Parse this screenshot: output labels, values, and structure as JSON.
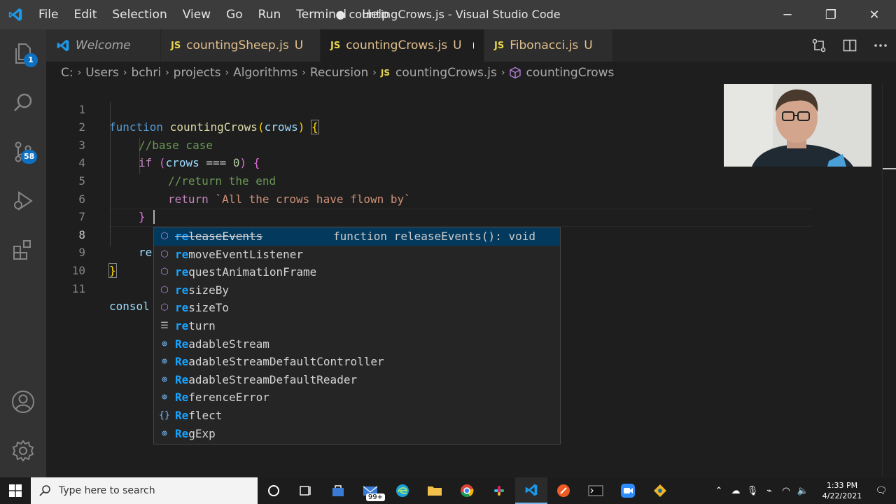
{
  "window": {
    "title": "● countingCrows.js - Visual Studio Code",
    "menu": [
      "File",
      "Edit",
      "Selection",
      "View",
      "Go",
      "Run",
      "Terminal",
      "Help"
    ],
    "controls": {
      "minimize": "─",
      "restore": "❐",
      "close": "✕"
    }
  },
  "activity_bar": {
    "items": [
      {
        "name": "explorer-icon",
        "badge": "1"
      },
      {
        "name": "search-icon"
      },
      {
        "name": "source-control-icon",
        "badge": "58"
      },
      {
        "name": "run-debug-icon"
      },
      {
        "name": "extensions-icon"
      }
    ],
    "bottom": [
      {
        "name": "account-icon"
      },
      {
        "name": "manage-gear-icon"
      }
    ]
  },
  "tabs": [
    {
      "label": "Welcome",
      "type": "welcome",
      "active": false
    },
    {
      "label": "countingSheep.js",
      "type": "JS",
      "status": "U",
      "active": false
    },
    {
      "label": "countingCrows.js",
      "type": "JS",
      "status": "U",
      "active": true,
      "dirty": true
    },
    {
      "label": "Fibonacci.js",
      "type": "JS",
      "status": "U",
      "active": false
    }
  ],
  "breadcrumb": {
    "parts": [
      "C:",
      "Users",
      "bchri",
      "projects",
      "Algorithms",
      "Recursion"
    ],
    "file": "countingCrows.js",
    "symbol": "countingCrows",
    "js_label": "JS"
  },
  "editor": {
    "line_numbers": [
      "1",
      "2",
      "3",
      "4",
      "5",
      "6",
      "7",
      "8",
      "9",
      "10",
      "11"
    ],
    "active_line": "8",
    "code": {
      "l1_kw": "function",
      "l1_fn": "countingCrows",
      "l1_paren_open": "(",
      "l1_param": "crows",
      "l1_paren_close": ")",
      "l1_brace": "{",
      "l2_comment": "//base case",
      "l3_kw": "if",
      "l3_open": "(",
      "l3_param": "crows",
      "l3_op": "===",
      "l3_num": "0",
      "l3_close": ")",
      "l3_brace": "{",
      "l4_comment": "//return the end",
      "l5_kw": "return",
      "l5_str": "`All the crows have flown by`",
      "l6_brace": "}",
      "l8_typed": "re",
      "l9_brace": "}",
      "l11_text": "consol"
    }
  },
  "suggestions": {
    "detail": "function releaseEvents(): void",
    "items": [
      {
        "match": "re",
        "rest": "leaseEvents",
        "kind": "method",
        "icon": "cube-icon",
        "deprecated": true,
        "selected": true
      },
      {
        "match": "re",
        "rest": "moveEventListener",
        "kind": "method",
        "icon": "cube-icon"
      },
      {
        "match": "re",
        "rest": "questAnimationFrame",
        "kind": "method",
        "icon": "cube-icon"
      },
      {
        "match": "re",
        "rest": "sizeBy",
        "kind": "method",
        "icon": "cube-icon"
      },
      {
        "match": "re",
        "rest": "sizeTo",
        "kind": "method",
        "icon": "cube-icon"
      },
      {
        "match": "re",
        "rest": "turn",
        "kind": "keyword",
        "icon": "keyword-icon"
      },
      {
        "match": "Re",
        "rest": "adableStream",
        "kind": "variable",
        "icon": "variable-icon"
      },
      {
        "match": "Re",
        "rest": "adableStreamDefaultController",
        "kind": "variable",
        "icon": "variable-icon"
      },
      {
        "match": "Re",
        "rest": "adableStreamDefaultReader",
        "kind": "variable",
        "icon": "variable-icon"
      },
      {
        "match": "Re",
        "rest": "ferenceError",
        "kind": "variable",
        "icon": "variable-icon"
      },
      {
        "match": "Re",
        "rest": "flect",
        "kind": "module",
        "icon": "braces-icon"
      },
      {
        "match": "Re",
        "rest": "gExp",
        "kind": "variable",
        "icon": "variable-icon"
      }
    ]
  },
  "taskbar": {
    "search_placeholder": "Type here to search",
    "mail_badge": "99+",
    "clock_time": "1:33 PM",
    "clock_date": "4/22/2021"
  },
  "colors": {
    "accent": "#007acc",
    "modified": "#e2c08d",
    "js": "#e8d44d"
  }
}
